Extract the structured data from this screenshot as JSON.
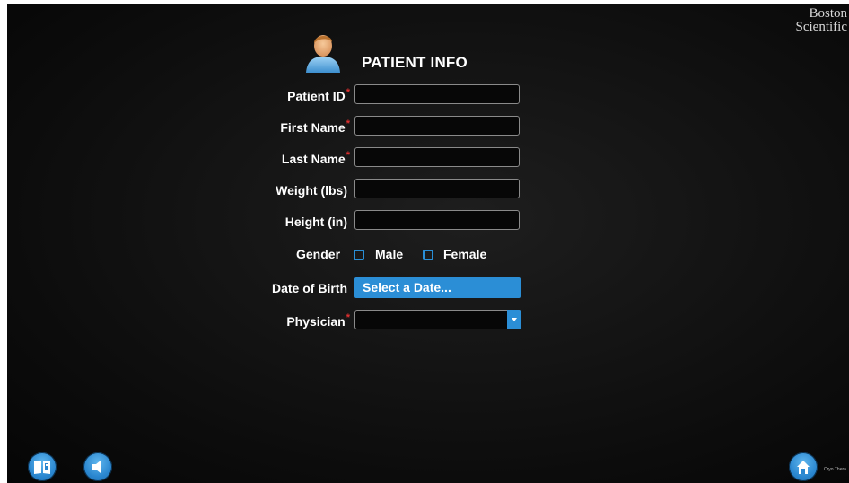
{
  "brand": {
    "line1": "Boston",
    "line2": "Scientific"
  },
  "header": {
    "title": "PATIENT INFO",
    "avatar_icon": "patient-avatar-icon"
  },
  "form": {
    "required_marker": "*",
    "patient_id": {
      "label": "Patient ID",
      "value": ""
    },
    "first_name": {
      "label": "First Name",
      "value": ""
    },
    "last_name": {
      "label": "Last Name",
      "value": ""
    },
    "weight": {
      "label": "Weight (lbs)",
      "value": ""
    },
    "height": {
      "label": "Height (in)",
      "value": ""
    },
    "gender": {
      "label": "Gender",
      "options": [
        "Male",
        "Female"
      ]
    },
    "dob": {
      "label": "Date of Birth",
      "value": "Select a Date..."
    },
    "physician": {
      "label": "Physician",
      "value": ""
    }
  },
  "footer": {
    "manual_icon": "manual-book-icon",
    "sound_icon": "speaker-icon",
    "home_icon": "home-icon",
    "trailing_text": "Cryo Thera"
  },
  "colors": {
    "accent": "#2b8ed6",
    "required": "#e03030",
    "background": "#0e0e0e"
  }
}
